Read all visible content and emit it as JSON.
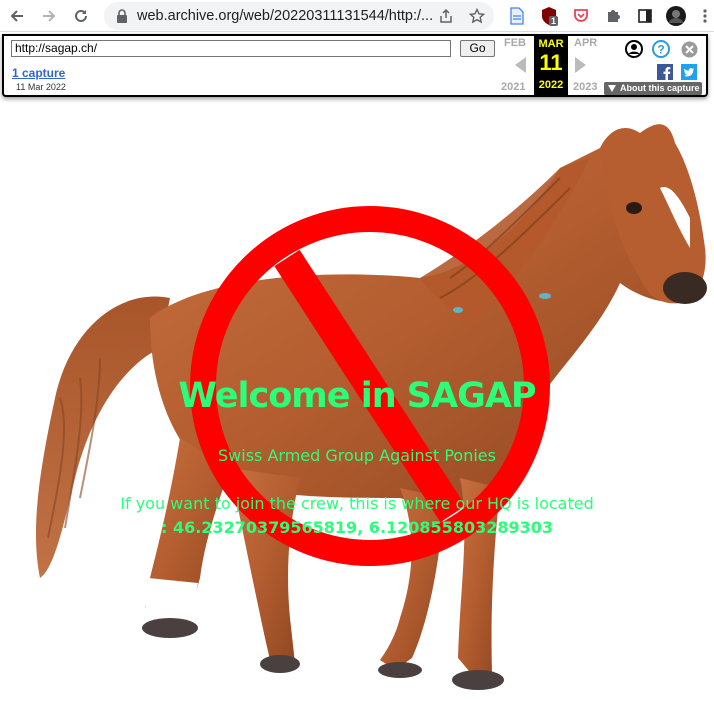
{
  "browser": {
    "url": "web.archive.org/web/20220311131544/http:/...",
    "extension_badge": "1"
  },
  "wayback": {
    "url_value": "http://sagap.ch/",
    "go_label": "Go",
    "captures_label": "1 capture",
    "capture_date": "11 Mar 2022",
    "prev_month": "FEB",
    "cur_month": "MAR",
    "next_month": "APR",
    "cur_day": "11",
    "prev_year": "2021",
    "cur_year": "2022",
    "next_year": "2023",
    "about_label": "About this capture"
  },
  "page": {
    "title": "Welcome in SAGAP",
    "subtitle": "Swiss Armed Group Against Ponies",
    "join_text": "If you want to join the crew, this is where our HQ is located",
    "coordinates": ": 46.23270379565819, 6.120855803289303",
    "text_color": "#2aff7a",
    "forbidden_color": "#ff0000"
  }
}
